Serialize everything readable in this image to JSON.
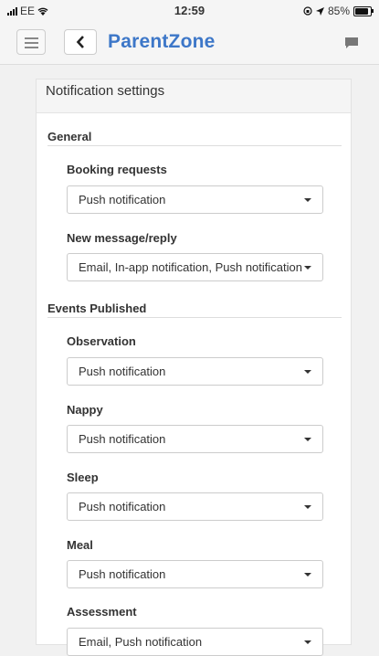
{
  "status_bar": {
    "carrier": "EE",
    "time": "12:59",
    "battery_text": "85%",
    "battery_level": 0.85
  },
  "header": {
    "brand": "ParentZone",
    "icons": [
      "menu-icon",
      "chevron-left-icon",
      "chat-icon"
    ]
  },
  "card": {
    "title": "Notification settings"
  },
  "sections": {
    "general": {
      "title": "General",
      "fields": [
        {
          "label": "Booking requests",
          "value": "Push notification"
        },
        {
          "label": "New message/reply",
          "value": "Email, In-app notification, Push notification"
        }
      ]
    },
    "events": {
      "title": "Events Published",
      "fields": [
        {
          "label": "Observation",
          "value": "Push notification"
        },
        {
          "label": "Nappy",
          "value": "Push notification"
        },
        {
          "label": "Sleep",
          "value": "Push notification"
        },
        {
          "label": "Meal",
          "value": "Push notification"
        },
        {
          "label": "Assessment",
          "value": "Email, Push notification"
        }
      ]
    }
  },
  "colors": {
    "brand": "#3d77c8",
    "background": "#f1f1f1"
  }
}
